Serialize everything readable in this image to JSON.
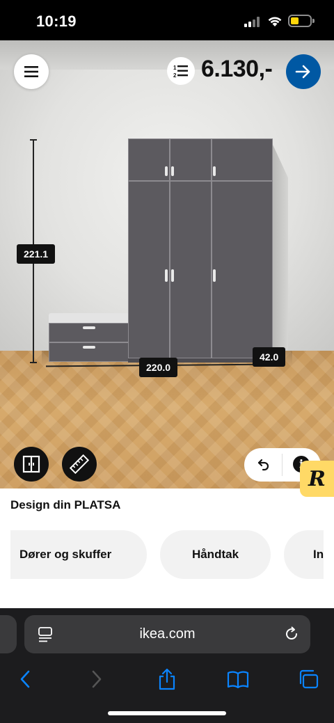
{
  "status_bar": {
    "time": "10:19"
  },
  "configurator": {
    "price": "6.130,-",
    "dimensions": {
      "height": "221.1",
      "width": "220.0",
      "depth": "42.0"
    }
  },
  "panel": {
    "title": "Design din PLATSA",
    "chips": [
      {
        "label": "Dører og skuffer"
      },
      {
        "label": "Håndtak"
      },
      {
        "label": "In"
      }
    ]
  },
  "browser": {
    "url": "ikea.com"
  },
  "colors": {
    "accent": "#0058a3",
    "badge": "#ffd966",
    "unit": "#5c5a5f"
  },
  "icons": {
    "top_left": "menu-icon",
    "top_middle": "numbered-list-icon",
    "top_right": "arrow-right-icon",
    "bottom_left": "door-icon",
    "bottom_second": "ruler-icon",
    "undo": "undo-icon",
    "info": "info-icon"
  }
}
